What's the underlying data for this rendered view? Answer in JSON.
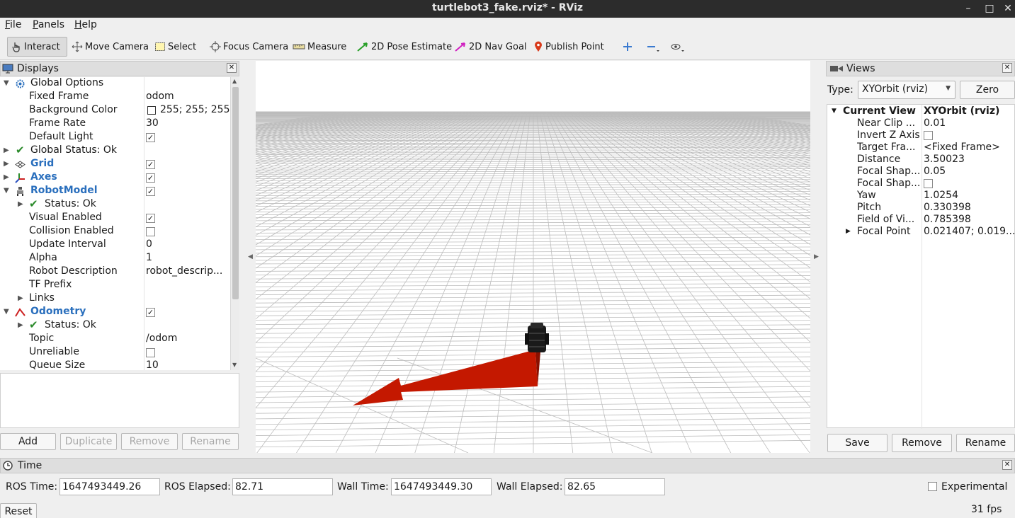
{
  "window": {
    "title": "turtlebot3_fake.rviz* - RViz",
    "minimize": "–",
    "maximize": "□",
    "close": "✕"
  },
  "menu": [
    "File",
    "Panels",
    "Help"
  ],
  "toolbar": {
    "tools": [
      "Interact",
      "Move Camera",
      "Select",
      "Focus Camera",
      "Measure",
      "2D Pose Estimate",
      "2D Nav Goal",
      "Publish Point"
    ],
    "active_tool": "Interact"
  },
  "displays": {
    "title": "Displays",
    "rows": [
      {
        "name": "Global Options",
        "value": ""
      },
      {
        "name": "Fixed Frame",
        "value": "odom"
      },
      {
        "name": "Background Color",
        "value": "255; 255; 255"
      },
      {
        "name": "Frame Rate",
        "value": "30"
      },
      {
        "name": "Default Light",
        "value": ""
      },
      {
        "name": "Global Status: Ok",
        "value": ""
      },
      {
        "name": "Grid",
        "value": ""
      },
      {
        "name": "Axes",
        "value": ""
      },
      {
        "name": "RobotModel",
        "value": ""
      },
      {
        "name": "Status: Ok",
        "value": ""
      },
      {
        "name": "Visual Enabled",
        "value": ""
      },
      {
        "name": "Collision Enabled",
        "value": ""
      },
      {
        "name": "Update Interval",
        "value": "0"
      },
      {
        "name": "Alpha",
        "value": "1"
      },
      {
        "name": "Robot Description",
        "value": "robot_descrip..."
      },
      {
        "name": "TF Prefix",
        "value": ""
      },
      {
        "name": "Links",
        "value": ""
      },
      {
        "name": "Odometry",
        "value": ""
      },
      {
        "name": "Status: Ok",
        "value": ""
      },
      {
        "name": "Topic",
        "value": "/odom"
      },
      {
        "name": "Unreliable",
        "value": ""
      },
      {
        "name": "Queue Size",
        "value": "10"
      }
    ],
    "buttons": {
      "add": "Add",
      "duplicate": "Duplicate",
      "remove": "Remove",
      "rename": "Rename"
    }
  },
  "views": {
    "title": "Views",
    "type_label": "Type:",
    "type_value": "XYOrbit (rviz)",
    "zero": "Zero",
    "rows": [
      {
        "name": "Current View",
        "value": "XYOrbit (rviz)"
      },
      {
        "name": "Near Clip ...",
        "value": "0.01"
      },
      {
        "name": "Invert Z Axis",
        "value": ""
      },
      {
        "name": "Target Fra...",
        "value": "<Fixed Frame>"
      },
      {
        "name": "Distance",
        "value": "3.50023"
      },
      {
        "name": "Focal Shap...",
        "value": "0.05"
      },
      {
        "name": "Focal Shap...",
        "value": ""
      },
      {
        "name": "Yaw",
        "value": "1.0254"
      },
      {
        "name": "Pitch",
        "value": "0.330398"
      },
      {
        "name": "Field of Vi...",
        "value": "0.785398"
      },
      {
        "name": "Focal Point",
        "value": "0.021407; 0.019..."
      }
    ],
    "buttons": {
      "save": "Save",
      "remove": "Remove",
      "rename": "Rename"
    }
  },
  "time": {
    "title": "Time",
    "ros_time_label": "ROS Time:",
    "ros_time": "1647493449.26",
    "ros_elapsed_label": "ROS Elapsed:",
    "ros_elapsed": "82.71",
    "wall_time_label": "Wall Time:",
    "wall_time": "1647493449.30",
    "wall_elapsed_label": "Wall Elapsed:",
    "wall_elapsed": "82.65",
    "experimental": "Experimental",
    "reset": "Reset",
    "fps": "31 fps"
  },
  "colors": {
    "display_name_blue": "#2a6fbd",
    "odometry_arrow": "#cc1a00"
  }
}
